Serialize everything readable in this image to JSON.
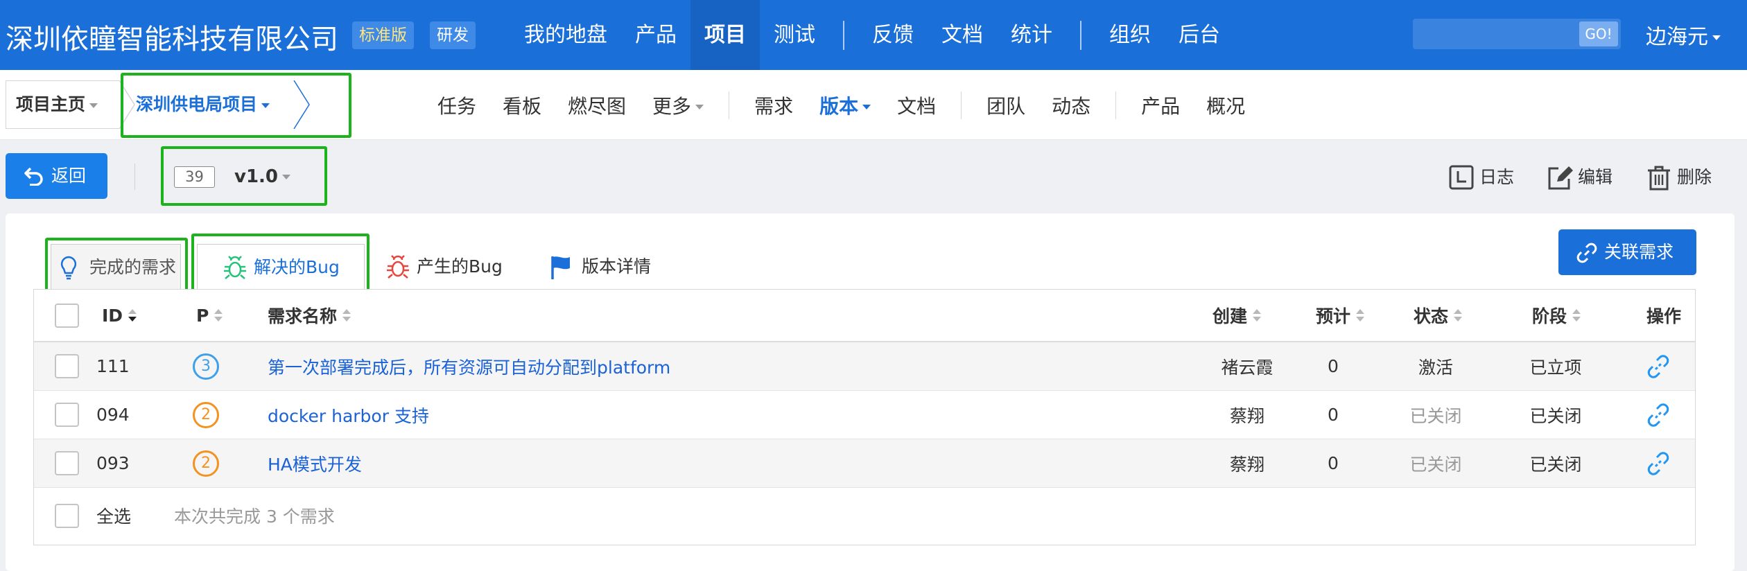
{
  "header": {
    "company": "深圳依瞳智能科技有限公司",
    "edition_badge": "标准版",
    "role_badge": "研发",
    "nav": [
      {
        "label": "我的地盘"
      },
      {
        "label": "产品"
      },
      {
        "label": "项目"
      },
      {
        "label": "测试"
      },
      {
        "label": "反馈"
      },
      {
        "label": "文档"
      },
      {
        "label": "统计"
      },
      {
        "label": "组织"
      },
      {
        "label": "后台"
      }
    ],
    "active_nav": "项目",
    "search_placeholder": "",
    "search_button": "GO!",
    "user": "边海元"
  },
  "subnav": {
    "home": "项目主页",
    "project": "深圳供电局项目",
    "items": [
      {
        "label": "任务"
      },
      {
        "label": "看板"
      },
      {
        "label": "燃尽图"
      },
      {
        "label": "更多"
      },
      {
        "label": "需求"
      },
      {
        "label": "版本"
      },
      {
        "label": "文档"
      },
      {
        "label": "团队"
      },
      {
        "label": "动态"
      },
      {
        "label": "产品"
      },
      {
        "label": "概况"
      }
    ],
    "active": "版本"
  },
  "toolbar": {
    "back": "返回",
    "version_id": "39",
    "version_name": "v1.0",
    "log": "日志",
    "edit": "编辑",
    "delete": "删除"
  },
  "tabs": {
    "completed_stories": "完成的需求",
    "resolved_bugs": "解决的Bug",
    "created_bugs": "产生的Bug",
    "version_details": "版本详情",
    "active": "解决的Bug"
  },
  "link_story_button": "关联需求",
  "table": {
    "headers": {
      "id": "ID",
      "pri": "P",
      "title": "需求名称",
      "creator": "创建",
      "estimate": "预计",
      "status": "状态",
      "stage": "阶段",
      "actions": "操作"
    },
    "rows": [
      {
        "id": "111",
        "pri": "3",
        "title": "第一次部署完成后，所有资源可自动分配到platform",
        "creator": "褚云霞",
        "estimate": "0",
        "status": "激活",
        "stage": "已立项"
      },
      {
        "id": "094",
        "pri": "2",
        "title": "docker harbor 支持",
        "creator": "蔡翔",
        "estimate": "0",
        "status": "已关闭",
        "stage": "已关闭"
      },
      {
        "id": "093",
        "pri": "2",
        "title": "HA模式开发",
        "creator": "蔡翔",
        "estimate": "0",
        "status": "已关闭",
        "stage": "已关闭"
      }
    ],
    "select_all": "全选",
    "summary": "本次共完成 3 个需求"
  },
  "colors": {
    "header_bg": "#1a6fd8",
    "accent": "#1a6fd8",
    "highlight": "#1db31d",
    "priority_3": "#3da0e8",
    "priority_2": "#f3921f"
  }
}
